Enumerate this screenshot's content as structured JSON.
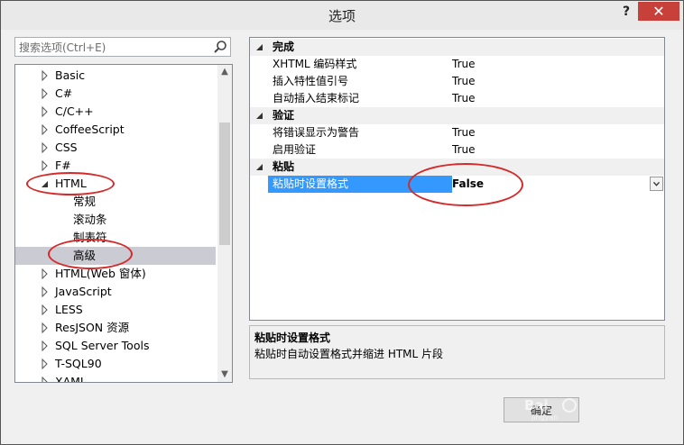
{
  "window": {
    "title": "选项",
    "help": "?",
    "close": "✕"
  },
  "search": {
    "placeholder": "搜索选项(Ctrl+E)"
  },
  "tree": {
    "items": [
      {
        "label": "Basic",
        "state": "collapsed"
      },
      {
        "label": "C#",
        "state": "collapsed"
      },
      {
        "label": "C/C++",
        "state": "collapsed"
      },
      {
        "label": "CoffeeScript",
        "state": "collapsed"
      },
      {
        "label": "CSS",
        "state": "collapsed"
      },
      {
        "label": "F#",
        "state": "collapsed"
      },
      {
        "label": "HTML",
        "state": "expanded"
      },
      {
        "label": "常规",
        "state": "child"
      },
      {
        "label": "滚动条",
        "state": "child"
      },
      {
        "label": "制表符",
        "state": "child"
      },
      {
        "label": "高级",
        "state": "child-selected"
      },
      {
        "label": "HTML(Web 窗体)",
        "state": "collapsed"
      },
      {
        "label": "JavaScript",
        "state": "collapsed"
      },
      {
        "label": "LESS",
        "state": "collapsed"
      },
      {
        "label": "ResJSON 资源",
        "state": "collapsed"
      },
      {
        "label": "SQL Server Tools",
        "state": "collapsed"
      },
      {
        "label": "T-SQL90",
        "state": "collapsed"
      },
      {
        "label": "XAML",
        "state": "collapsed"
      }
    ]
  },
  "grid": {
    "categories": [
      {
        "name": "完成",
        "props": [
          {
            "name": "XHTML 编码样式",
            "value": "True"
          },
          {
            "name": "插入特性值引号",
            "value": "True"
          },
          {
            "name": "自动插入结束标记",
            "value": "True"
          }
        ]
      },
      {
        "name": "验证",
        "props": [
          {
            "name": "将错误显示为警告",
            "value": "True"
          },
          {
            "name": "启用验证",
            "value": "True"
          }
        ]
      },
      {
        "name": "粘贴",
        "props": [
          {
            "name": "粘贴时设置格式",
            "value": "False"
          }
        ]
      }
    ]
  },
  "description": {
    "title": "粘贴时设置格式",
    "text": "粘贴时自动设置格式并缩进 HTML 片段"
  },
  "buttons": {
    "ok": "确定"
  },
  "colors": {
    "selection": "#3399ff",
    "close": "#c7403a",
    "annotation": "#d42a2a"
  }
}
